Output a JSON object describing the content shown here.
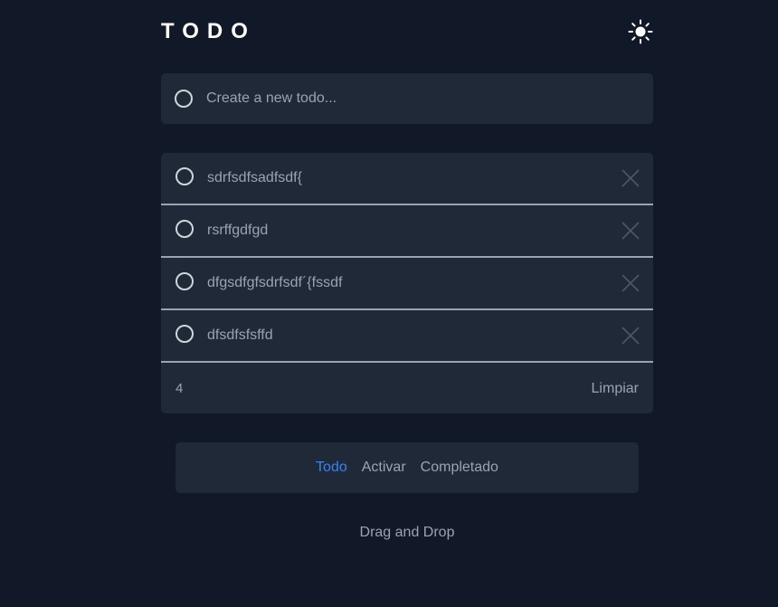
{
  "header": {
    "title": "TODO",
    "theme_icon": "sun-icon"
  },
  "new_todo": {
    "placeholder": "Create a new todo..."
  },
  "todos": [
    {
      "text": "sdrfsdfsadfsdf{",
      "completed": false
    },
    {
      "text": "rsrffgdfgd",
      "completed": false
    },
    {
      "text": "dfgsdfgfsdrfsdf´{fssdf",
      "completed": false
    },
    {
      "text": "dfsdfsfsffd",
      "completed": false
    }
  ],
  "footer": {
    "count": "4",
    "clear_label": "Limpiar"
  },
  "filters": [
    {
      "label": "Todo",
      "active": true
    },
    {
      "label": "Activar",
      "active": false
    },
    {
      "label": "Completado",
      "active": false
    }
  ],
  "hint": "Drag and Drop",
  "colors": {
    "background": "#111827",
    "card": "#1f2937",
    "accent": "#3b82f6",
    "muted": "#9ca3af"
  }
}
